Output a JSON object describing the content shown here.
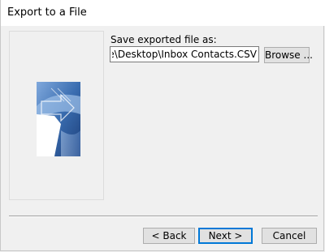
{
  "window": {
    "title": "Export to a File"
  },
  "form": {
    "save_label": "Save exported file as:",
    "path_value": "obhanororke\\Desktop\\Inbox Contacts.CSV",
    "browse_label": "Browse ..."
  },
  "buttons": {
    "back_label": "< Back",
    "next_label": "Next >",
    "cancel_label": "Cancel"
  },
  "colors": {
    "accent": "#0078d7",
    "wizard_image_blue": "#3a6db0"
  },
  "icons": {
    "wizard_image": "export-wizard-illustration"
  }
}
